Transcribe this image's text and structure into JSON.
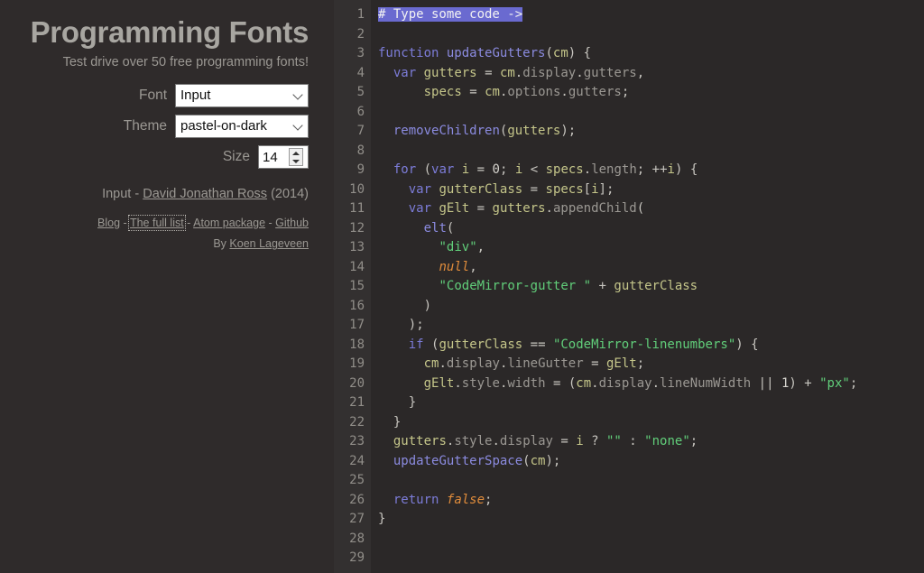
{
  "sidebar": {
    "title": "Programming Fonts",
    "subtitle": "Test drive over 50 free programming fonts!",
    "form": {
      "font_label": "Font",
      "font_value": "Input",
      "font_options": [
        "Input"
      ],
      "theme_label": "Theme",
      "theme_value": "pastel-on-dark",
      "theme_options": [
        "pastel-on-dark"
      ],
      "size_label": "Size",
      "size_value": "14"
    },
    "credit": {
      "font_name": "Input",
      "dash": " - ",
      "designer": "David Jonathan Ross",
      "year": " (2014)"
    },
    "links": [
      {
        "label": "Blog",
        "focused": false
      },
      {
        "label": "The full list",
        "focused": true
      },
      {
        "label": "Atom package",
        "focused": false
      },
      {
        "label": "Github",
        "focused": false
      }
    ],
    "link_separator": " - ",
    "byline_prefix": "By ",
    "byline_author": "Koen Lageveen"
  },
  "editor": {
    "theme_name": "pastel-on-dark",
    "background": "#2b2828",
    "gutter_background": "#333030",
    "selection_color": "#6a6ad0",
    "line_numbers": [
      "1",
      "2",
      "3",
      "4",
      "5",
      "6",
      "7",
      "8",
      "9",
      "10",
      "11",
      "12",
      "13",
      "14",
      "15",
      "16",
      "17",
      "18",
      "19",
      "20",
      "21",
      "22",
      "23",
      "24",
      "25",
      "26",
      "27",
      "28",
      "29"
    ],
    "lines": [
      "# Type some code ->",
      "",
      "function updateGutters(cm) {",
      "  var gutters = cm.display.gutters,",
      "      specs = cm.options.gutters;",
      "",
      "  removeChildren(gutters);",
      "",
      "  for (var i = 0; i < specs.length; ++i) {",
      "    var gutterClass = specs[i];",
      "    var gElt = gutters.appendChild(",
      "      elt(",
      "        \"div\",",
      "        null,",
      "        \"CodeMirror-gutter \" + gutterClass",
      "      )",
      "    );",
      "    if (gutterClass == \"CodeMirror-linenumbers\") {",
      "      cm.display.lineGutter = gElt;",
      "      gElt.style.width = (cm.display.lineNumWidth || 1) + \"px\";",
      "    }",
      "  }",
      "  gutters.style.display = i ? \"\" : \"none\";",
      "  updateGutterSpace(cm);",
      "",
      "  return false;",
      "}",
      "",
      ""
    ]
  }
}
